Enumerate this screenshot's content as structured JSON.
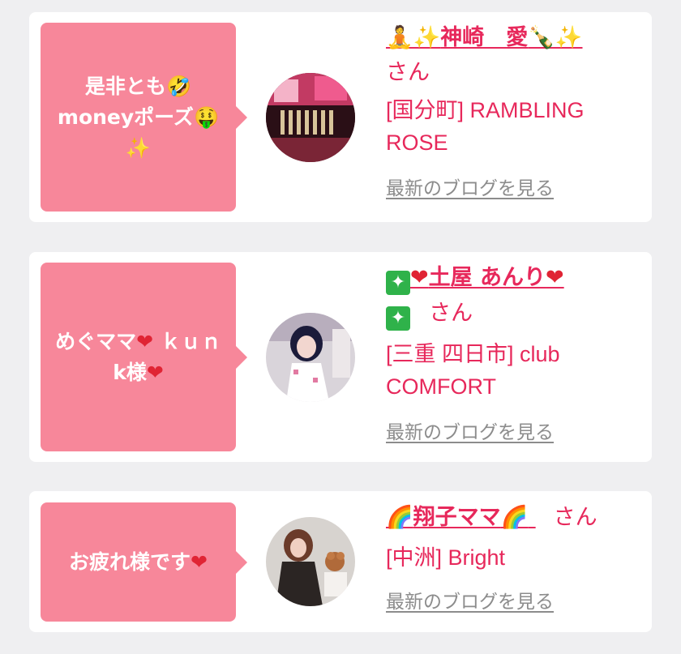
{
  "cards": [
    {
      "message_line1": "是非とも",
      "message_emoji1": "🤣",
      "message_line2": "moneyポーズ",
      "message_emoji2": "🤑",
      "message_line3": "✨",
      "name_prefix": "🧘✨",
      "name": "神崎　愛",
      "name_suffix": "🍾✨",
      "san": "さん",
      "shop_line1": "[国分町] RAMBLING",
      "shop_line2": "ROSE",
      "blog_link": "最新のブログを見る"
    },
    {
      "message_line1": "めぐママ",
      "message_heart": "❤",
      "message_line1b": " ｋｕｎ",
      "message_line2": "k様",
      "message_heart2": "❤",
      "name_box1": "✦",
      "name_heart1": "❤",
      "name": "土屋 あんり",
      "name_heart2": "❤",
      "name_box2": "✦",
      "san": "さん",
      "shop_line1": "[三重 四日市] club",
      "shop_line2": "COMFORT",
      "blog_link": "最新のブログを見る"
    },
    {
      "message_line1": "お疲れ様です",
      "message_heart": "❤",
      "name_prefix": "🌈",
      "name": "翔子ママ",
      "name_suffix": "🌈",
      "san": "さん",
      "shop_line1": "[中洲] Bright",
      "blog_link": "最新のブログを見る"
    }
  ]
}
